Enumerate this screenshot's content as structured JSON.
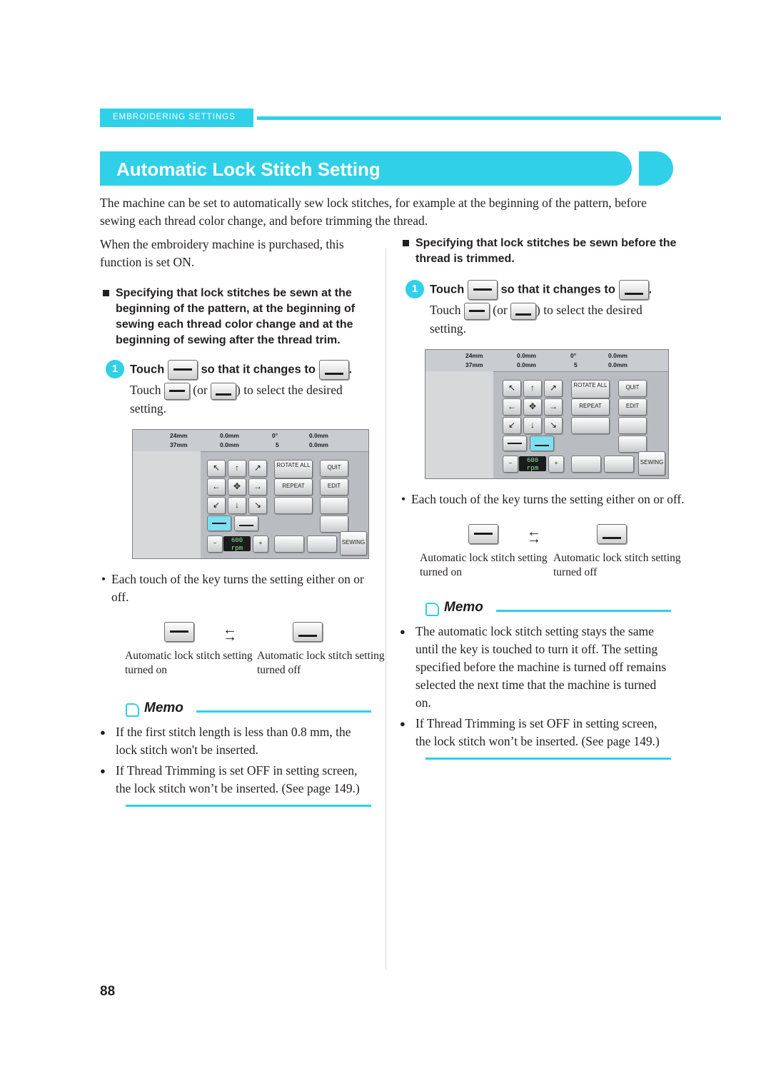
{
  "header": {
    "section": "EMBROIDERING SETTINGS"
  },
  "title": "Automatic Lock Stitch Setting",
  "intro": "The machine can be set to automatically sew lock stitches, for example at the beginning of the pattern, before sewing each thread color change, and before trimming the thread.",
  "left": {
    "para1": "When the embroidery machine is purchased, this function is set ON.",
    "heading": "Specifying that lock stitches be sewn at the beginning of the pattern, at the beginning of sewing each thread color change and at the beginning of sewing after the thread trim.",
    "step_num": "1",
    "step_bold_pre": "Touch",
    "step_bold_mid": "so that it changes to",
    "step_bold_end": ".",
    "step_line2_pre": "Touch",
    "step_line2_or": "(or",
    "step_line2_post": ") to select the desired",
    "step_line3": "setting.",
    "bullet": "Each touch of the key turns the setting either on or off.",
    "cap_on": "Automatic lock stitch setting turned on",
    "cap_off": "Automatic lock stitch setting turned off",
    "memo_title": "Memo",
    "memo_items": [
      "If the first stitch length is less than 0.8 mm, the lock stitch won't be inserted.",
      "If Thread Trimming is set OFF in setting screen, the lock stitch won’t be inserted. (See page 149.)"
    ]
  },
  "right": {
    "heading": "Specifying that lock stitches be sewn before the thread is trimmed.",
    "step_num": "1",
    "step_bold_pre": "Touch",
    "step_bold_mid": "so that it changes to",
    "step_bold_end": ".",
    "step_line2_pre": "Touch",
    "step_line2_or": "(or",
    "step_line2_post": ") to select the desired",
    "step_line3": "setting.",
    "bullet": "Each touch of the key turns the setting either on or off.",
    "cap_on": "Automatic lock stitch setting turned on",
    "cap_off": "Automatic lock stitch setting turned off",
    "memo_title": "Memo",
    "memo_items": [
      "The automatic lock stitch setting stays the same until the key is touched to turn it off. The setting specified before the machine is turned off remains selected the next time that the machine is turned on.",
      "If Thread Trimming is set OFF in setting screen, the lock stitch won’t be inserted. (See page 149.)"
    ]
  },
  "lcd": {
    "size_w": "24mm",
    "size_h": "37mm",
    "pos_v": "0.0mm",
    "pos_h": "0.0mm",
    "angle": "0°",
    "color_count": "5",
    "offset_v": "0.0mm",
    "offset_h": "0.0mm",
    "rotate_all": "ROTATE ALL",
    "repeat": "REPEAT",
    "quit": "QUIT",
    "edit": "EDIT",
    "sewing": "SEWING",
    "speed": "600",
    "speed_unit": "rpm",
    "minus": "−",
    "plus": "+",
    "arrows": [
      "↖",
      "↑",
      "↗",
      "←",
      "✥",
      "→",
      "↙",
      "↓",
      "↘"
    ]
  },
  "page_number": "88"
}
